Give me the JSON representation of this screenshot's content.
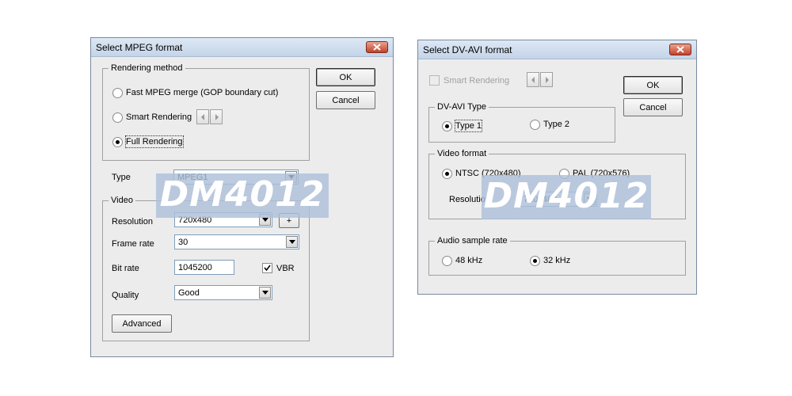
{
  "watermark": "DM4012",
  "colors": {
    "title_gradient_top": "#dde8f4",
    "close_button": "#c4412a",
    "watermark_bg": "#adbfd9"
  },
  "mpeg": {
    "title": "Select MPEG format",
    "ok_label": "OK",
    "cancel_label": "Cancel",
    "rendering": {
      "label": "Rendering method",
      "fast": "Fast MPEG merge (GOP boundary cut)",
      "smart": "Smart Rendering",
      "full": "Full Rendering",
      "selected": "full"
    },
    "type_label": "Type",
    "type_value": "MPEG1",
    "video": {
      "label": "Video",
      "resolution_label": "Resolution",
      "resolution_value": "720x480",
      "plus_label": "+",
      "framerate_label": "Frame rate",
      "framerate_value": "30",
      "bitrate_label": "Bit rate",
      "bitrate_value": "1045200",
      "vbr_label": "VBR",
      "vbr_checked": true,
      "quality_label": "Quality",
      "quality_value": "Good",
      "advanced_label": "Advanced"
    }
  },
  "dvavi": {
    "title": "Select DV-AVI format",
    "smart_label": "Smart Rendering",
    "ok_label": "OK",
    "cancel_label": "Cancel",
    "type_group": {
      "label": "DV-AVI Type",
      "type1": "Type 1",
      "type2": "Type 2",
      "selected": "type1"
    },
    "video_format": {
      "label": "Video format",
      "ntsc": "NTSC (720x480)",
      "pal": "PAL (720x576)",
      "selected": "ntsc",
      "resolution_label": "Resolution",
      "resolution_value": "720x480"
    },
    "audio": {
      "label": "Audio sample rate",
      "r48": "48 kHz",
      "r32": "32 kHz",
      "selected": "32khz"
    }
  }
}
